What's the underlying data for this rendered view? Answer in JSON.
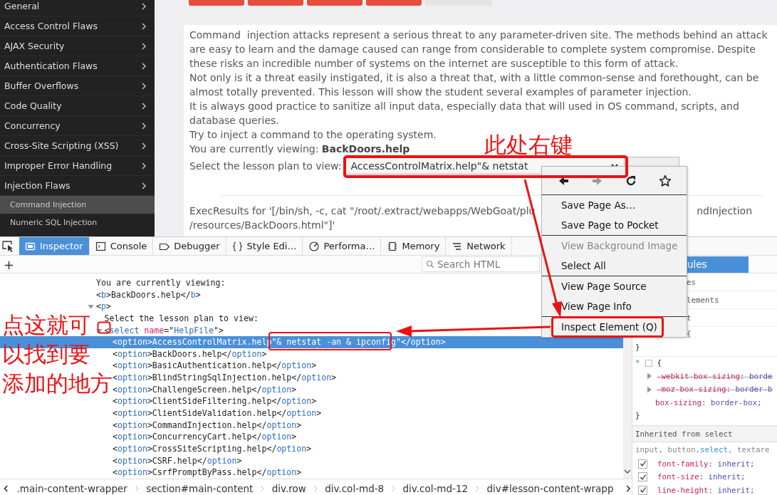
{
  "sidebar": {
    "items": [
      {
        "label": "General"
      },
      {
        "label": "Access Control Flaws"
      },
      {
        "label": "AJAX Security"
      },
      {
        "label": "Authentication Flaws"
      },
      {
        "label": "Buffer Overflows"
      },
      {
        "label": "Code Quality"
      },
      {
        "label": "Concurrency"
      },
      {
        "label": "Cross-Site Scripting (XSS)"
      },
      {
        "label": "Improper Error Handling"
      },
      {
        "label": "Injection Flaws",
        "children": [
          {
            "label": "Command Injection",
            "selected": true
          },
          {
            "label": "Numeric SQL Injection",
            "selected": false
          }
        ]
      }
    ]
  },
  "lesson_buttons": [
    {
      "kind": "accent"
    },
    {
      "kind": "accent"
    },
    {
      "kind": "accent"
    },
    {
      "kind": "accent"
    },
    {
      "kind": "plain"
    }
  ],
  "lesson": {
    "paragraphs": [
      "Command  injection attacks represent a serious threat to any parameter-driven site. The methods behind an attack are easy to learn and the damage caused can range from considerable to complete system compromise. Despite these risks an incredible number of systems on the internet are susceptible to this form of attack.",
      "Not only is it a threat easily instigated, it is also a threat that, with a little common-sense and forethought, can be almost totally prevented. This lesson will show the student several examples of parameter injection.",
      "It is always good practice to sanitize all input data, especially data that will used in OS command, scripts, and database queries.",
      "Try to inject a command to the operating system.",
      "You are currently viewing: **BackDoors.help**"
    ],
    "select_label": "Select the lesson plan to view:",
    "select_value": "AccessControlMatrix.help\"& netstat",
    "exec_results": {
      "line_1_start": "ExecResults for '[/bin/sh, -c, cat \"/root/.extract/webapps/WebGoat/plu",
      "line_1_end": "ndInjection",
      "line_2": "/resources/BackDoors.html\"]'"
    }
  },
  "annotations": {
    "right_click_note": "此处右键",
    "find_note_lines": [
      "点这就可",
      "以找到要",
      "添加的地方"
    ]
  },
  "context_menu": {
    "nav": [
      {
        "kind": "back",
        "disabled": false
      },
      {
        "kind": "forward",
        "disabled": true
      },
      {
        "kind": "reload",
        "disabled": false
      },
      {
        "kind": "bookmark",
        "disabled": false
      }
    ],
    "groups": [
      [
        {
          "label": "Save Page As…",
          "disabled": false
        },
        {
          "label": "Save Page to Pocket",
          "disabled": false
        }
      ],
      [
        {
          "label": "View Background Image",
          "disabled": true
        },
        {
          "label": "Select All",
          "disabled": false
        }
      ],
      [
        {
          "label": "View Page Source",
          "disabled": false
        },
        {
          "label": "View Page Info",
          "disabled": false
        }
      ],
      [
        {
          "label": "Inspect Element (Q)",
          "disabled": false
        }
      ]
    ]
  },
  "devtools": {
    "tabs": [
      {
        "kind": "inspector",
        "label": "Inspector",
        "selected": true
      },
      {
        "kind": "console",
        "label": "Console",
        "selected": false
      },
      {
        "kind": "debugger",
        "label": "Debugger",
        "selected": false
      },
      {
        "kind": "style",
        "label": "Style Edi…",
        "selected": false
      },
      {
        "kind": "performance",
        "label": "Performa…",
        "selected": false
      },
      {
        "kind": "memory",
        "label": "Memory",
        "selected": false
      },
      {
        "kind": "network",
        "label": "Network",
        "selected": false
      }
    ],
    "add_button": "+",
    "search": {
      "placeholder": "Search HTML"
    },
    "side_tab": {
      "label": "ules",
      "selected": true
    },
    "markup": [
      {
        "tokens": [
          {
            "kind": "text",
            "text": "You are currently viewing:"
          }
        ]
      },
      {
        "tokens": [
          {
            "kind": "punct",
            "text": "<"
          },
          {
            "kind": "tag",
            "text": "b"
          },
          {
            "kind": "punct",
            "text": ">"
          },
          {
            "kind": "text",
            "text": "BackDoors.help"
          },
          {
            "kind": "punct",
            "text": "</"
          },
          {
            "kind": "tag",
            "text": "b"
          },
          {
            "kind": "punct",
            "text": ">"
          }
        ]
      },
      {
        "expanded": true,
        "tokens": [
          {
            "kind": "punct",
            "text": "<"
          },
          {
            "kind": "tag",
            "text": "p"
          },
          {
            "kind": "punct",
            "text": ">"
          }
        ],
        "children": [
          {
            "tokens": [
              {
                "kind": "text",
                "text": "Select the lesson plan to view:"
              }
            ]
          },
          {
            "expanded": true,
            "tokens": [
              {
                "kind": "punct",
                "text": "<"
              },
              {
                "kind": "tag",
                "text": "select"
              },
              {
                "kind": "attr",
                "text": "name"
              },
              {
                "kind": "punct",
                "text": "=\""
              },
              {
                "kind": "value",
                "text": "HelpFile"
              },
              {
                "kind": "punct",
                "text": "\">"
              }
            ],
            "children": [
              {
                "selected": true,
                "tokens": [
                  {
                    "kind": "punct",
                    "text": "<"
                  },
                  {
                    "kind": "tag",
                    "text": "option"
                  },
                  {
                    "kind": "punct",
                    "text": ">"
                  },
                  {
                    "kind": "text",
                    "text": "AccessControlMatrix.help\"& netstat -an & ipconfig\""
                  },
                  {
                    "kind": "punct",
                    "text": "</"
                  },
                  {
                    "kind": "tag",
                    "text": "option"
                  },
                  {
                    "kind": "punct",
                    "text": ">"
                  }
                ]
              },
              {
                "selected": false,
                "tokens": [
                  {
                    "kind": "punct",
                    "text": "<"
                  },
                  {
                    "kind": "tag",
                    "text": "option"
                  },
                  {
                    "kind": "punct",
                    "text": ">"
                  },
                  {
                    "kind": "text",
                    "text": "BackDoors.help"
                  },
                  {
                    "kind": "punct",
                    "text": "</"
                  },
                  {
                    "kind": "tag",
                    "text": "option"
                  },
                  {
                    "kind": "punct",
                    "text": ">"
                  }
                ]
              },
              {
                "selected": false,
                "tokens": [
                  {
                    "kind": "punct",
                    "text": "<"
                  },
                  {
                    "kind": "tag",
                    "text": "option"
                  },
                  {
                    "kind": "punct",
                    "text": ">"
                  },
                  {
                    "kind": "text",
                    "text": "BasicAuthentication.help"
                  },
                  {
                    "kind": "punct",
                    "text": "</"
                  },
                  {
                    "kind": "tag",
                    "text": "option"
                  },
                  {
                    "kind": "punct",
                    "text": ">"
                  }
                ]
              },
              {
                "selected": false,
                "tokens": [
                  {
                    "kind": "punct",
                    "text": "<"
                  },
                  {
                    "kind": "tag",
                    "text": "option"
                  },
                  {
                    "kind": "punct",
                    "text": ">"
                  },
                  {
                    "kind": "text",
                    "text": "BlindStringSqlInjection.help"
                  },
                  {
                    "kind": "punct",
                    "text": "</"
                  },
                  {
                    "kind": "tag",
                    "text": "option"
                  },
                  {
                    "kind": "punct",
                    "text": ">"
                  }
                ]
              },
              {
                "selected": false,
                "tokens": [
                  {
                    "kind": "punct",
                    "text": "<"
                  },
                  {
                    "kind": "tag",
                    "text": "option"
                  },
                  {
                    "kind": "punct",
                    "text": ">"
                  },
                  {
                    "kind": "text",
                    "text": "ChallengeScreen.help"
                  },
                  {
                    "kind": "punct",
                    "text": "</"
                  },
                  {
                    "kind": "tag",
                    "text": "option"
                  },
                  {
                    "kind": "punct",
                    "text": ">"
                  }
                ]
              },
              {
                "selected": false,
                "tokens": [
                  {
                    "kind": "punct",
                    "text": "<"
                  },
                  {
                    "kind": "tag",
                    "text": "option"
                  },
                  {
                    "kind": "punct",
                    "text": ">"
                  },
                  {
                    "kind": "text",
                    "text": "ClientSideFiltering.help"
                  },
                  {
                    "kind": "punct",
                    "text": "</"
                  },
                  {
                    "kind": "tag",
                    "text": "option"
                  },
                  {
                    "kind": "punct",
                    "text": ">"
                  }
                ]
              },
              {
                "selected": false,
                "tokens": [
                  {
                    "kind": "punct",
                    "text": "<"
                  },
                  {
                    "kind": "tag",
                    "text": "option"
                  },
                  {
                    "kind": "punct",
                    "text": ">"
                  },
                  {
                    "kind": "text",
                    "text": "ClientSideValidation.help"
                  },
                  {
                    "kind": "punct",
                    "text": "</"
                  },
                  {
                    "kind": "tag",
                    "text": "option"
                  },
                  {
                    "kind": "punct",
                    "text": ">"
                  }
                ]
              },
              {
                "selected": false,
                "tokens": [
                  {
                    "kind": "punct",
                    "text": "<"
                  },
                  {
                    "kind": "tag",
                    "text": "option"
                  },
                  {
                    "kind": "punct",
                    "text": ">"
                  },
                  {
                    "kind": "text",
                    "text": "CommandInjection.help"
                  },
                  {
                    "kind": "punct",
                    "text": "</"
                  },
                  {
                    "kind": "tag",
                    "text": "option"
                  },
                  {
                    "kind": "punct",
                    "text": ">"
                  }
                ]
              },
              {
                "selected": false,
                "tokens": [
                  {
                    "kind": "punct",
                    "text": "<"
                  },
                  {
                    "kind": "tag",
                    "text": "option"
                  },
                  {
                    "kind": "punct",
                    "text": ">"
                  },
                  {
                    "kind": "text",
                    "text": "ConcurrencyCart.help"
                  },
                  {
                    "kind": "punct",
                    "text": "</"
                  },
                  {
                    "kind": "tag",
                    "text": "option"
                  },
                  {
                    "kind": "punct",
                    "text": ">"
                  }
                ]
              },
              {
                "selected": false,
                "tokens": [
                  {
                    "kind": "punct",
                    "text": "<"
                  },
                  {
                    "kind": "tag",
                    "text": "option"
                  },
                  {
                    "kind": "punct",
                    "text": ">"
                  },
                  {
                    "kind": "text",
                    "text": "CrossSiteScripting.help"
                  },
                  {
                    "kind": "punct",
                    "text": "</"
                  },
                  {
                    "kind": "tag",
                    "text": "option"
                  },
                  {
                    "kind": "punct",
                    "text": ">"
                  }
                ]
              },
              {
                "selected": false,
                "tokens": [
                  {
                    "kind": "punct",
                    "text": "<"
                  },
                  {
                    "kind": "tag",
                    "text": "option"
                  },
                  {
                    "kind": "punct",
                    "text": ">"
                  },
                  {
                    "kind": "text",
                    "text": "CSRF.help"
                  },
                  {
                    "kind": "punct",
                    "text": "</"
                  },
                  {
                    "kind": "tag",
                    "text": "option"
                  },
                  {
                    "kind": "punct",
                    "text": ">"
                  }
                ]
              },
              {
                "selected": false,
                "tokens": [
                  {
                    "kind": "punct",
                    "text": "<"
                  },
                  {
                    "kind": "tag",
                    "text": "option"
                  },
                  {
                    "kind": "punct",
                    "text": ">"
                  },
                  {
                    "kind": "text",
                    "text": "CsrfPromptByPass.help"
                  },
                  {
                    "kind": "punct",
                    "text": "</"
                  },
                  {
                    "kind": "tag",
                    "text": "option"
                  },
                  {
                    "kind": "punct",
                    "text": ">"
                  }
                ]
              }
            ]
          }
        ]
      }
    ],
    "rules": [
      {
        "kind": "fragment",
        "text": "es"
      },
      {
        "kind": "fragment",
        "text": "lements"
      },
      {
        "kind": "fragment",
        "text": "t"
      },
      {
        "kind": "fragment",
        "text": "{"
      },
      {
        "kind": "brace",
        "text": "}"
      },
      {
        "kind": "rule",
        "selector": "*",
        "open": "{",
        "declarations": [
          {
            "property": "-webkit-box-sizing",
            "value": ": borde",
            "overridden": true
          },
          {
            "property": "-moz-box-sizing",
            "value": ": border-b",
            "overridden": true
          },
          {
            "property": "box-sizing",
            "value": ": border-box;",
            "overridden": false
          }
        ],
        "close": "}"
      },
      {
        "kind": "header",
        "text": "Inherited from select"
      },
      {
        "kind": "selector",
        "parts": [
          {
            "text": "input, button, ",
            "matched": false
          },
          {
            "text": "select",
            "matched": true
          },
          {
            "text": ", textare",
            "matched": false
          }
        ]
      },
      {
        "kind": "declaration",
        "property": "font-family",
        "value": ": inherit;",
        "checked": true
      },
      {
        "kind": "declaration",
        "property": "font-size",
        "value": ": inherit;",
        "checked": true
      },
      {
        "kind": "declaration",
        "property": "line-height",
        "value": ": inherit;",
        "checked": true
      }
    ],
    "breadcrumbs": [
      ".main-content-wrapper",
      "section#main-content",
      "div.row",
      "div.col-md-8",
      "div.col-md-12",
      "div#lesson-content-wrapp"
    ]
  }
}
